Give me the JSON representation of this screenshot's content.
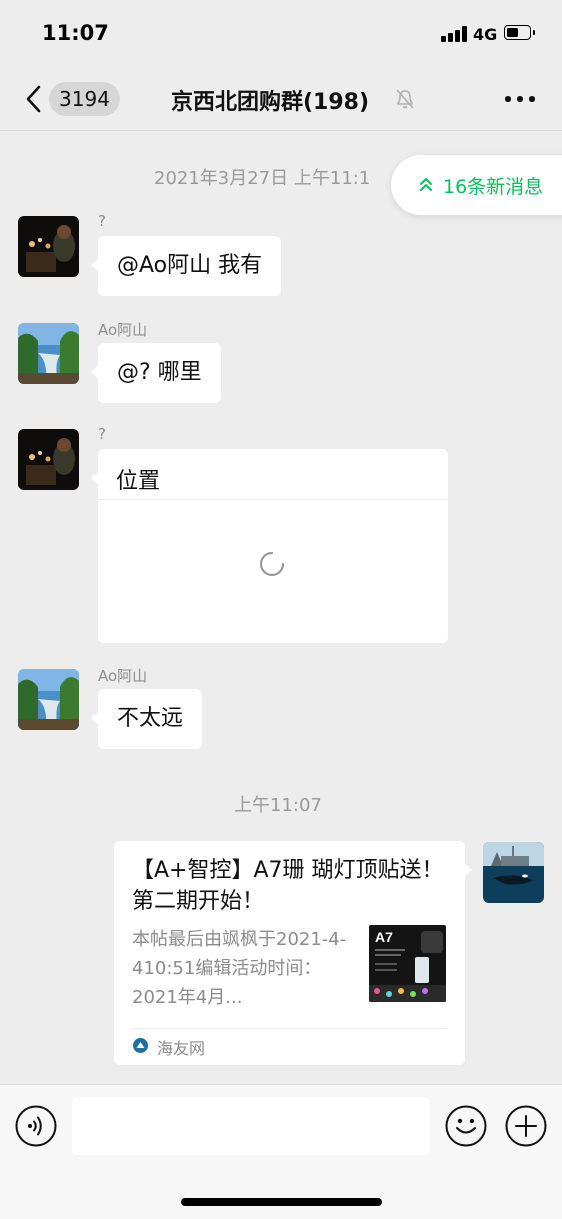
{
  "status_bar": {
    "time": "11:07",
    "network": "4G"
  },
  "nav": {
    "back_count": "3194",
    "title": "京西北团购群(198)"
  },
  "banner": {
    "new_messages": "16条新消息"
  },
  "time_separators": [
    "2021年3月27日 上午11:1",
    "上午11:07"
  ],
  "messages": [
    {
      "sender": "?",
      "text": "@Ao阿山 我有"
    },
    {
      "sender": "Ao阿山",
      "text": "@?  哪里"
    },
    {
      "sender": "?",
      "type": "location",
      "text": "位置"
    },
    {
      "sender": "Ao阿山",
      "text": "不太远"
    },
    {
      "sender": "me",
      "type": "link",
      "title": "【A+智控】A7珊 瑚灯顶贴送！第二期开始！",
      "description": "本帖最后由飒枫于2021-4-410:51编辑活动时间：2021年4月...",
      "thumb_label": "A7",
      "source": "海友网"
    }
  ],
  "input": {
    "placeholder": ""
  }
}
